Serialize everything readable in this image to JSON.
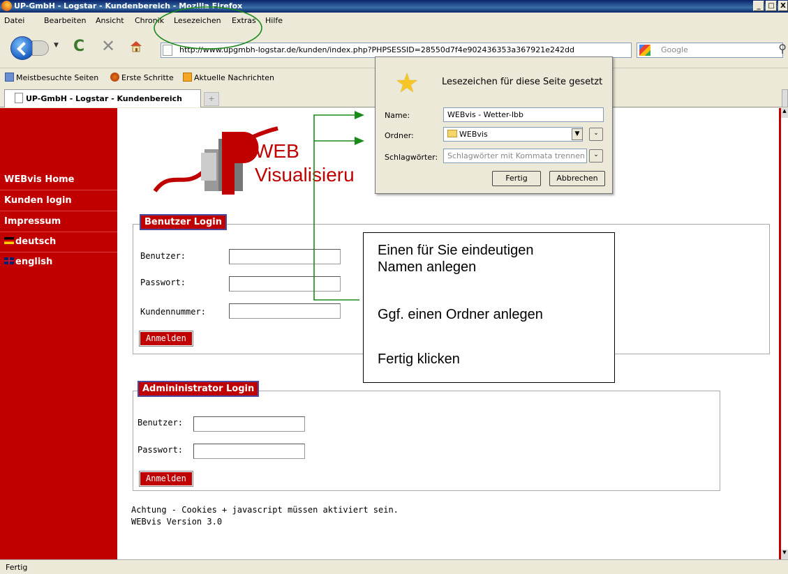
{
  "window": {
    "title": "UP-GmbH - Logstar - Kundenbereich - Mozilla Firefox",
    "controls": [
      "_",
      "□",
      "X"
    ]
  },
  "menubar": {
    "items": [
      "Datei",
      "Bearbeiten",
      "Ansicht",
      "Chronik",
      "Lesezeichen",
      "Extras",
      "Hilfe"
    ]
  },
  "navbar": {
    "url": "http://www.upgmbh-logstar.de/kunden/index.php?PHPSESSID=28550d7f4e902436353a367921e242dd",
    "search_placeholder": "Google"
  },
  "bookmarks_bar": {
    "items": [
      "Meistbesuchte Seiten",
      "Erste Schritte",
      "Aktuelle Nachrichten"
    ]
  },
  "tabs": [
    {
      "label": "UP-GmbH - Logstar - Kundenbereich"
    }
  ],
  "sidebar": {
    "items": [
      {
        "label": "WEBvis Home"
      },
      {
        "label": "Kunden login"
      },
      {
        "label": "Impressum"
      },
      {
        "label": "deutsch",
        "flag": "de"
      },
      {
        "label": "english",
        "flag": "uk"
      }
    ]
  },
  "logo": {
    "line1": "WEB",
    "line2": "Visualisieru"
  },
  "user_login": {
    "legend": "Benutzer Login",
    "user_label": "Benutzer:",
    "password_label": "Passwort:",
    "customer_label": "Kundennummer:",
    "submit": "Anmelden"
  },
  "admin_login": {
    "legend": "Admininistrator Login",
    "user_label": "Benutzer:",
    "password_label": "Passwort:",
    "submit": "Anmelden"
  },
  "notes": {
    "line1": "Achtung - Cookies + javascript müssen aktiviert sein.",
    "line2": "WEBvis Version 3.0"
  },
  "callout": {
    "line1": "Einen für Sie eindeutigen",
    "line2": "Namen anlegen",
    "line3": "Ggf. einen Ordner anlegen",
    "line4": "Fertig klicken"
  },
  "bookmark_popup": {
    "title": "Lesezeichen für diese Seite gesetzt",
    "name_label": "Name:",
    "name_value": "WEBvis - Wetter-Ibb",
    "folder_label": "Ordner:",
    "folder_value": "WEBvis",
    "tags_label": "Schlagwörter:",
    "tags_placeholder": "Schlagwörter mit Kommata trennen",
    "done_button": "Fertig",
    "cancel_button": "Abbrechen"
  },
  "statusbar": {
    "text": "Fertig"
  },
  "colors": {
    "sidebar": "#c00000",
    "annotation_arrow": "#1a8a1a",
    "titlebar": "#0a246a"
  }
}
